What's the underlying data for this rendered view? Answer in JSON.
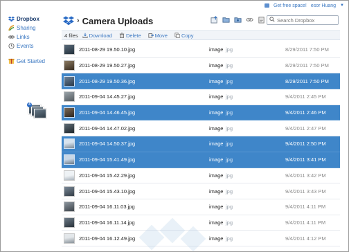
{
  "topbar": {
    "promo": "Get free space!",
    "user": "esor Huang",
    "caret": "▼"
  },
  "sidebar": {
    "items": [
      {
        "label": "Dropbox",
        "icon": "dropbox-icon"
      },
      {
        "label": "Sharing",
        "icon": "sharing-icon"
      },
      {
        "label": "Links",
        "icon": "link-icon"
      },
      {
        "label": "Events",
        "icon": "events-icon"
      },
      {
        "label": "Get Started",
        "icon": "get-started-icon"
      }
    ]
  },
  "drag": {
    "count": "4"
  },
  "header": {
    "separator": "›",
    "title": "Camera Uploads"
  },
  "search": {
    "placeholder": "Search Dropbox"
  },
  "actions": {
    "count": "4 files",
    "download": "Download",
    "delete": "Delete",
    "move": "Move",
    "copy": "Copy"
  },
  "files": [
    {
      "name": "2011-08-29 19.50.10.jpg",
      "kind": "image",
      "ext": "jpg",
      "date": "8/29/2011 7:50 PM",
      "selected": false
    },
    {
      "name": "2011-08-29 19.50.27.jpg",
      "kind": "image",
      "ext": "jpg",
      "date": "8/29/2011 7:50 PM",
      "selected": false
    },
    {
      "name": "2011-08-29 19.50.36.jpg",
      "kind": "image",
      "ext": "jpg",
      "date": "8/29/2011 7:50 PM",
      "selected": true
    },
    {
      "name": "2011-09-04 14.45.27.jpg",
      "kind": "image",
      "ext": "jpg",
      "date": "9/4/2011 2:45 PM",
      "selected": false
    },
    {
      "name": "2011-09-04 14.46.45.jpg",
      "kind": "image",
      "ext": "jpg",
      "date": "9/4/2011 2:46 PM",
      "selected": true
    },
    {
      "name": "2011-09-04 14.47.02.jpg",
      "kind": "image",
      "ext": "jpg",
      "date": "9/4/2011 2:47 PM",
      "selected": false
    },
    {
      "name": "2011-09-04 14.50.37.jpg",
      "kind": "image",
      "ext": "jpg",
      "date": "9/4/2011 2:50 PM",
      "selected": true
    },
    {
      "name": "2011-09-04 15.41.49.jpg",
      "kind": "image",
      "ext": "jpg",
      "date": "9/4/2011 3:41 PM",
      "selected": true
    },
    {
      "name": "2011-09-04 15.42.29.jpg",
      "kind": "image",
      "ext": "jpg",
      "date": "9/4/2011 3:42 PM",
      "selected": false
    },
    {
      "name": "2011-09-04 15.43.10.jpg",
      "kind": "image",
      "ext": "jpg",
      "date": "9/4/2011 3:43 PM",
      "selected": false
    },
    {
      "name": "2011-09-04 16.11.03.jpg",
      "kind": "image",
      "ext": "jpg",
      "date": "9/4/2011 4:11 PM",
      "selected": false
    },
    {
      "name": "2011-09-04 16.11.14.jpg",
      "kind": "image",
      "ext": "jpg",
      "date": "9/4/2011 4:11 PM",
      "selected": false
    },
    {
      "name": "2011-09-04 16.12.49.jpg",
      "kind": "image",
      "ext": "jpg",
      "date": "9/4/2011 4:12 PM",
      "selected": false
    }
  ],
  "colors": {
    "selection": "#3f86c9",
    "link": "#3b78c2"
  }
}
